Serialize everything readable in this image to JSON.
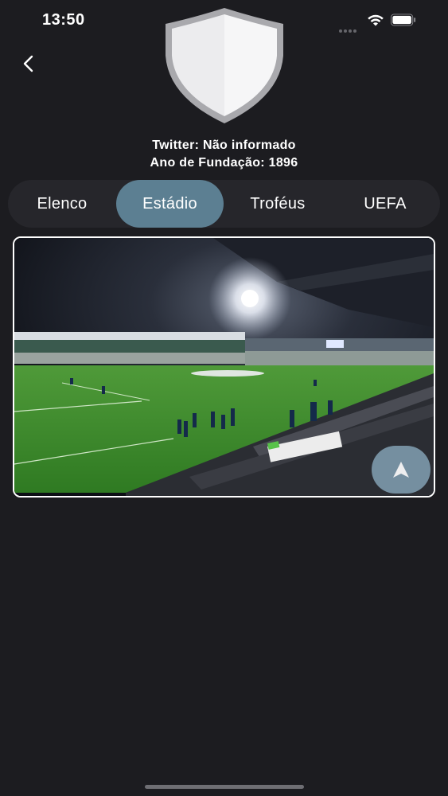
{
  "status_bar": {
    "time": "13:50",
    "icons": [
      "signal-icon",
      "wifi-icon",
      "battery-icon"
    ]
  },
  "header": {
    "back_icon": "chevron-left-icon",
    "crest_icon": "shield-crest-icon"
  },
  "club_info": {
    "twitter": "Twitter: Não informado",
    "founded": "Ano de Fundação: 1896"
  },
  "tabs": [
    {
      "label": "Elenco",
      "active": false
    },
    {
      "label": "Estádio",
      "active": true
    },
    {
      "label": "Troféus",
      "active": false
    },
    {
      "label": "UEFA",
      "active": false
    }
  ],
  "stadium": {
    "image_icon": "stadium-photo",
    "navigate_icon": "navigation-arrow-icon"
  },
  "colors": {
    "background": "#1c1c20",
    "tab_bar": "#26262b",
    "tab_active": "#5c7f92",
    "nav_button": "#7c98aa",
    "pitch": "#3f8d2c"
  }
}
